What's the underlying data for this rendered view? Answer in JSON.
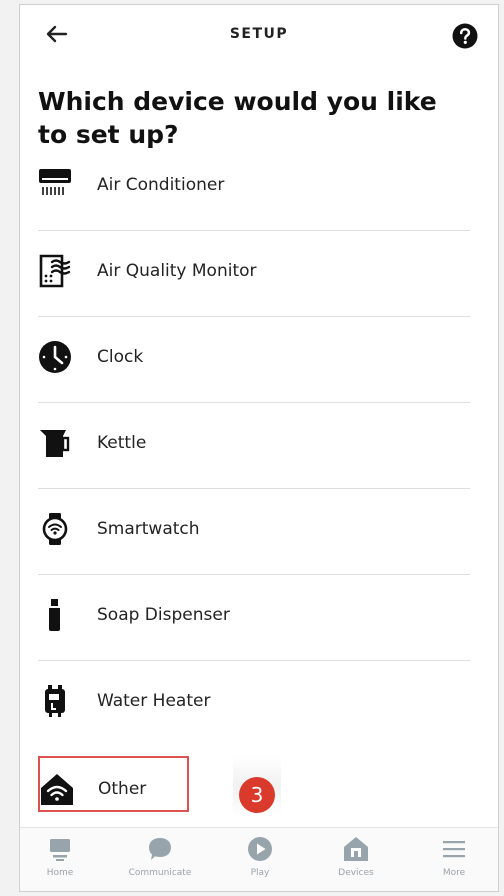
{
  "header": {
    "title": "SETUP",
    "back_icon": "arrow-left-icon",
    "help_icon": "question-circle-icon"
  },
  "heading": "Which device would you like to set up?",
  "devices": [
    {
      "label": "Air Conditioner",
      "icon": "air-conditioner-icon"
    },
    {
      "label": "Air Quality Monitor",
      "icon": "air-quality-monitor-icon"
    },
    {
      "label": "Clock",
      "icon": "clock-icon"
    },
    {
      "label": "Kettle",
      "icon": "kettle-icon"
    },
    {
      "label": "Smartwatch",
      "icon": "smartwatch-icon"
    },
    {
      "label": "Soap Dispenser",
      "icon": "soap-dispenser-icon"
    },
    {
      "label": "Water Heater",
      "icon": "water-heater-icon"
    }
  ],
  "other": {
    "label": "Other",
    "icon": "wifi-home-icon"
  },
  "step_badge": "3",
  "colors": {
    "highlight": "#d9534f",
    "badge": "#d93a2b",
    "nav_icon": "#98a4ab"
  },
  "nav": [
    {
      "label": "Home",
      "icon": "home-icon"
    },
    {
      "label": "Communicate",
      "icon": "chat-bubble-icon"
    },
    {
      "label": "Play",
      "icon": "play-icon"
    },
    {
      "label": "Devices",
      "icon": "devices-house-icon"
    },
    {
      "label": "More",
      "icon": "menu-lines-icon"
    }
  ]
}
